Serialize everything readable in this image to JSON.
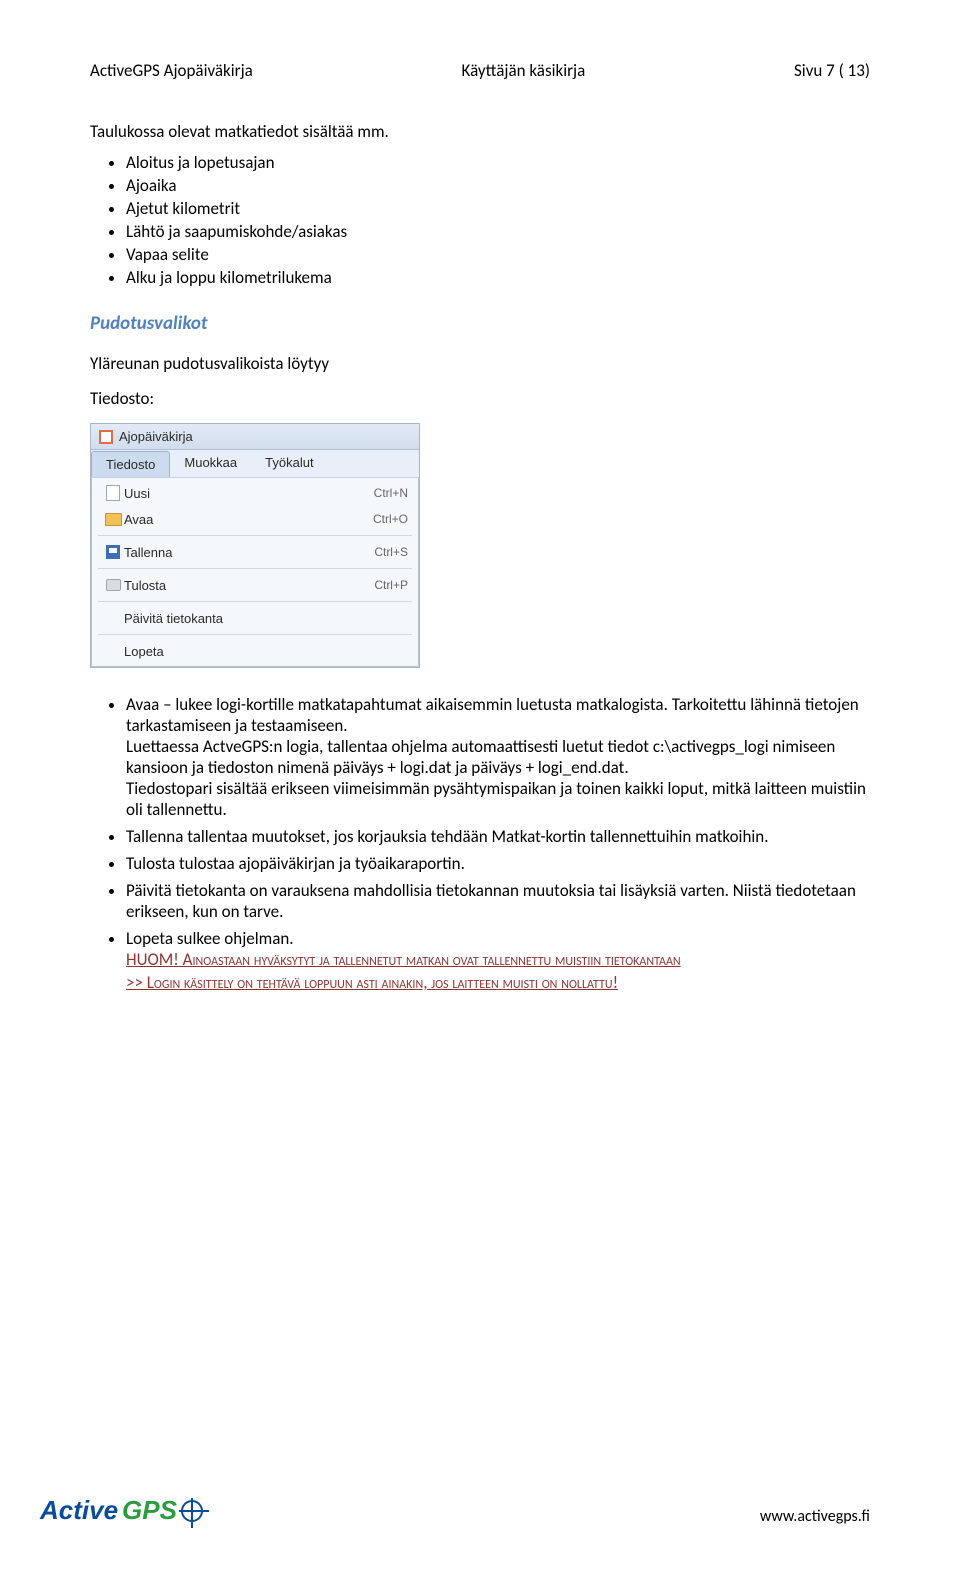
{
  "header": {
    "left": "ActiveGPS Ajopäiväkirja",
    "center": "Käyttäjän käsikirja",
    "right": "Sivu 7 ( 13)"
  },
  "intro": "Taulukossa olevat matkatiedot sisältää mm.",
  "first_list": [
    "Aloitus ja lopetusajan",
    "Ajoaika",
    "Ajetut kilometrit",
    "Lähtö ja saapumiskohde/asiakas",
    "Vapaa selite",
    "Alku ja loppu kilometrilukema"
  ],
  "section_title": "Pudotusvalikot",
  "section_intro": "Yläreunan pudotusvalikoista löytyy",
  "label_tiedosto": "Tiedosto:",
  "win": {
    "title": "Ajopäiväkirja",
    "menubar": [
      "Tiedosto",
      "Muokkaa",
      "Työkalut"
    ],
    "items": [
      {
        "label": "Uusi",
        "shortcut": "Ctrl+N",
        "icon": "new"
      },
      {
        "label": "Avaa",
        "shortcut": "Ctrl+O",
        "icon": "open"
      },
      {
        "label": "Tallenna",
        "shortcut": "Ctrl+S",
        "icon": "save"
      },
      {
        "label": "Tulosta",
        "shortcut": "Ctrl+P",
        "icon": "print"
      },
      {
        "label": "Päivitä tietokanta",
        "shortcut": "",
        "icon": ""
      },
      {
        "label": "Lopeta",
        "shortcut": "",
        "icon": ""
      }
    ]
  },
  "main_list": [
    "Avaa – lukee logi-kortille matkatapahtumat aikaisemmin luetusta matkalogista. Tarkoitettu lähinnä tietojen tarkastamiseen ja testaamiseen.\nLuettaessa ActveGPS:n logia, tallentaa ohjelma automaattisesti luetut tiedot c:\\activegps_logi nimiseen kansioon ja tiedoston nimenä päiväys + logi.dat ja päiväys + logi_end.dat.\nTiedostopari sisältää erikseen viimeisimmän pysähtymispaikan ja toinen kaikki loput, mitkä laitteen muistiin oli tallennettu.",
    "Tallenna tallentaa muutokset, jos korjauksia tehdään Matkat-kortin tallennettuihin matkoihin.",
    "Tulosta tulostaa ajopäiväkirjan ja työaikaraportin.",
    "Päivitä tietokanta on varauksena mahdollisia tietokannan muutoksia tai lisäyksiä varten. Niistä tiedotetaan erikseen, kun on tarve.",
    "Lopeta sulkee ohjelman."
  ],
  "huom_label": "HUOM!",
  "huom_line1": " Ainoastaan hyväksytyt ja tallennetut matkan ovat tallennettu muistiin tietokantaan",
  "huom_line2": ">> Login käsittely on tehtävä loppuun asti ainakin, jos laitteen muisti on nollattu!",
  "footer": {
    "brand_a": "Active",
    "brand_b": "GPS",
    "url": "www.activegps.fi"
  }
}
